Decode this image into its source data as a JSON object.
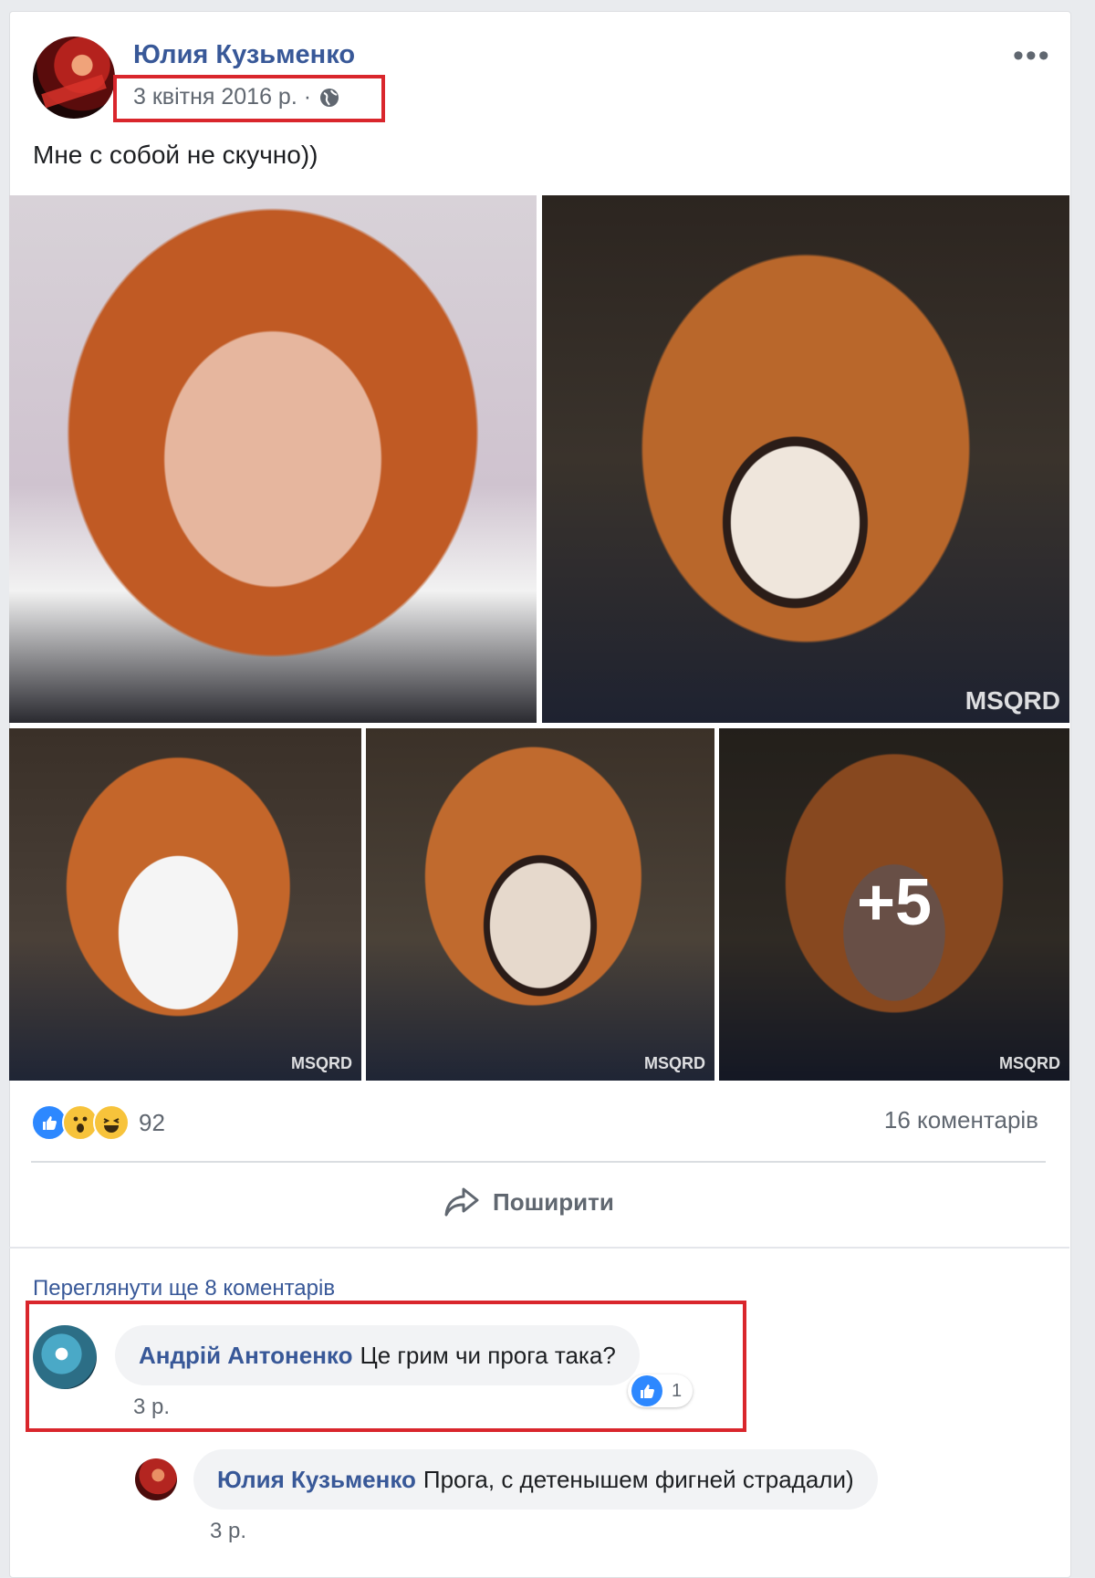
{
  "post": {
    "author": "Юлия Кузьменко",
    "date": "3 квітня 2016 р. ·",
    "text": "Мне с собой не скучно))",
    "more_label": "•••",
    "photos": [
      {
        "name": "photo-1",
        "watermark": ""
      },
      {
        "name": "photo-2",
        "watermark": "MSQRD"
      },
      {
        "name": "photo-3",
        "watermark": "MSQRD"
      },
      {
        "name": "photo-4",
        "watermark": "MSQRD"
      },
      {
        "name": "photo-5",
        "watermark": "MSQRD"
      }
    ],
    "extra_photos": "+5"
  },
  "stats": {
    "reactions": [
      "like",
      "wow",
      "haha"
    ],
    "reactions_count": "92",
    "comments_count": "16 коментарів"
  },
  "actions": {
    "share": "Поширити"
  },
  "comments": {
    "view_more": "Переглянути ще 8 коментарів",
    "items": [
      {
        "author": "Андрій Антоненко",
        "text": "Це грим чи прога така?",
        "time": "3 р.",
        "likes": "1"
      },
      {
        "author": "Юлия Кузьменко",
        "text": "Прога, с детенышем фигней страдали)",
        "time": "3 р."
      }
    ]
  },
  "colors": {
    "link": "#385898",
    "highlight": "#d9262c",
    "like": "#2d88ff",
    "background": "#e9ebee"
  }
}
